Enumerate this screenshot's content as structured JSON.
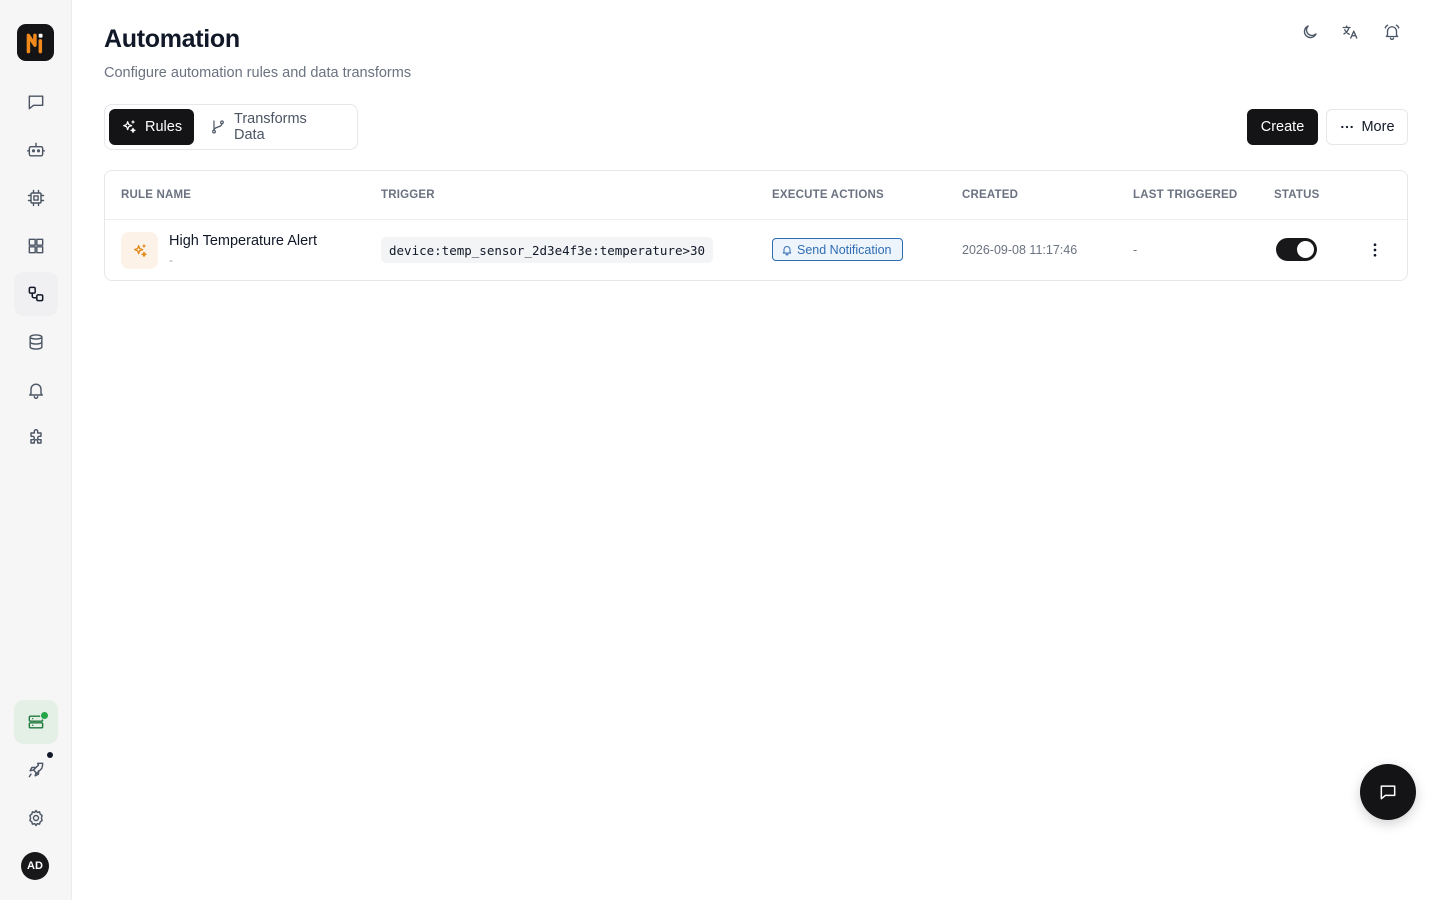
{
  "app": {
    "brand_color": "#141416",
    "accent_orange": "#f28a1b"
  },
  "sidebar": {
    "items": [
      {
        "icon": "chat-icon"
      },
      {
        "icon": "bot-icon"
      },
      {
        "icon": "chip-icon"
      },
      {
        "icon": "dashboard-icon"
      },
      {
        "icon": "workflow-icon",
        "active": true
      },
      {
        "icon": "database-icon"
      },
      {
        "icon": "bell-icon"
      },
      {
        "icon": "puzzle-icon"
      }
    ],
    "bottom": [
      {
        "icon": "server-icon",
        "status": "online"
      },
      {
        "icon": "rocket-icon",
        "badge": true
      },
      {
        "icon": "gear-icon"
      }
    ],
    "avatar_initials": "AD"
  },
  "header": {
    "title": "Automation",
    "subtitle": "Configure automation rules and data transforms"
  },
  "toolbar": {
    "tabs": [
      {
        "label": "Rules",
        "icon": "sparkles-icon",
        "active": true
      },
      {
        "label": "Transforms Data",
        "icon": "git-branch-icon",
        "active": false
      }
    ],
    "create_label": "Create",
    "more_label": "More"
  },
  "table": {
    "headers": {
      "rule_name": "Rule Name",
      "trigger": "Trigger",
      "execute_actions": "Execute Actions",
      "created": "Created",
      "last_triggered": "Last Triggered",
      "status": "Status"
    },
    "rows": [
      {
        "name": "High Temperature Alert",
        "description": "-",
        "trigger": "device:temp_sensor_2d3e4f3e:temperature>30",
        "action": "Send Notification",
        "created": "2026-09-08 11:17:46",
        "last_triggered": "-",
        "enabled": true
      }
    ]
  }
}
